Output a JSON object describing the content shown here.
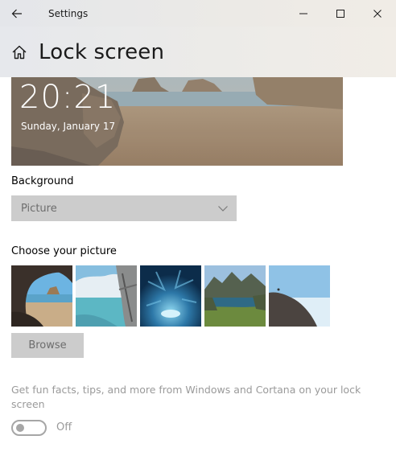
{
  "window": {
    "title": "Settings"
  },
  "header": {
    "title": "Lock screen"
  },
  "preview": {
    "time": "20:21",
    "date": "Sunday, January 17"
  },
  "background": {
    "label": "Background",
    "selected": "Picture"
  },
  "picture_chooser": {
    "label": "Choose your picture",
    "thumbnails": [
      "cave-beach",
      "sea-cliff-window",
      "ice-cave",
      "mountain-lake",
      "rocky-shore"
    ],
    "browse_label": "Browse"
  },
  "tips": {
    "text": "Get fun facts, tips, and more from Windows and Cortana on your lock screen",
    "toggle_state": "Off"
  },
  "icons": {
    "back": "back-arrow-icon",
    "home": "home-icon",
    "minimize": "minimize-icon",
    "maximize": "maximize-icon",
    "close": "close-icon",
    "dropdown": "chevron-down-icon"
  },
  "colors": {
    "control_disabled_bg": "#cccccc",
    "disabled_text": "#9a9a9a"
  }
}
